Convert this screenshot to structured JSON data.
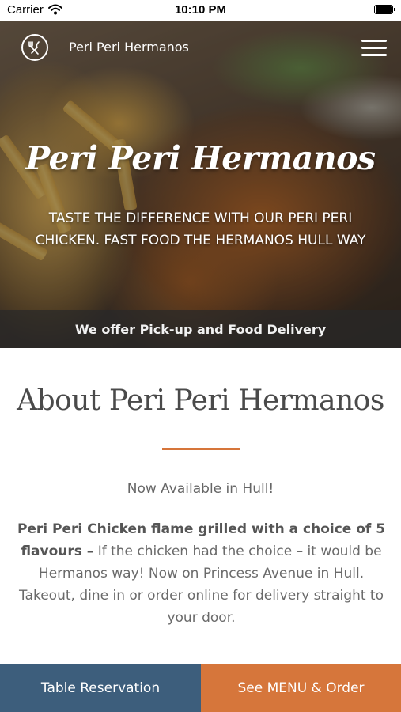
{
  "status_bar": {
    "carrier": "Carrier",
    "time": "10:10 PM"
  },
  "nav": {
    "brand": "Peri Peri Hermanos",
    "logo_icon": "fork-knife-heart-icon",
    "menu_icon": "hamburger-menu-icon"
  },
  "hero": {
    "title": "Peri Peri Hermanos",
    "tagline": "TASTE THE DIFFERENCE WITH OUR PERI PERI CHICKEN. FAST FOOD THE HERMANOS HULL WAY",
    "banner": "We offer Pick-up and Food Delivery"
  },
  "about": {
    "title": "About Peri Peri Hermanos",
    "subtitle": "Now Available in Hull!",
    "text_bold": "Peri Peri Chicken flame grilled with a choice of 5 flavours –",
    "text_rest": " If the chicken had the choice – it would be Hermanos way! Now on Princess Avenue in Hull. Takeout, dine in or order online for delivery straight to your door."
  },
  "actions": {
    "reserve_label": "Table Reservation",
    "menu_label": "See MENU & Order"
  },
  "colors": {
    "accent_orange": "#d6763b",
    "accent_blue": "#3d5e7c"
  }
}
